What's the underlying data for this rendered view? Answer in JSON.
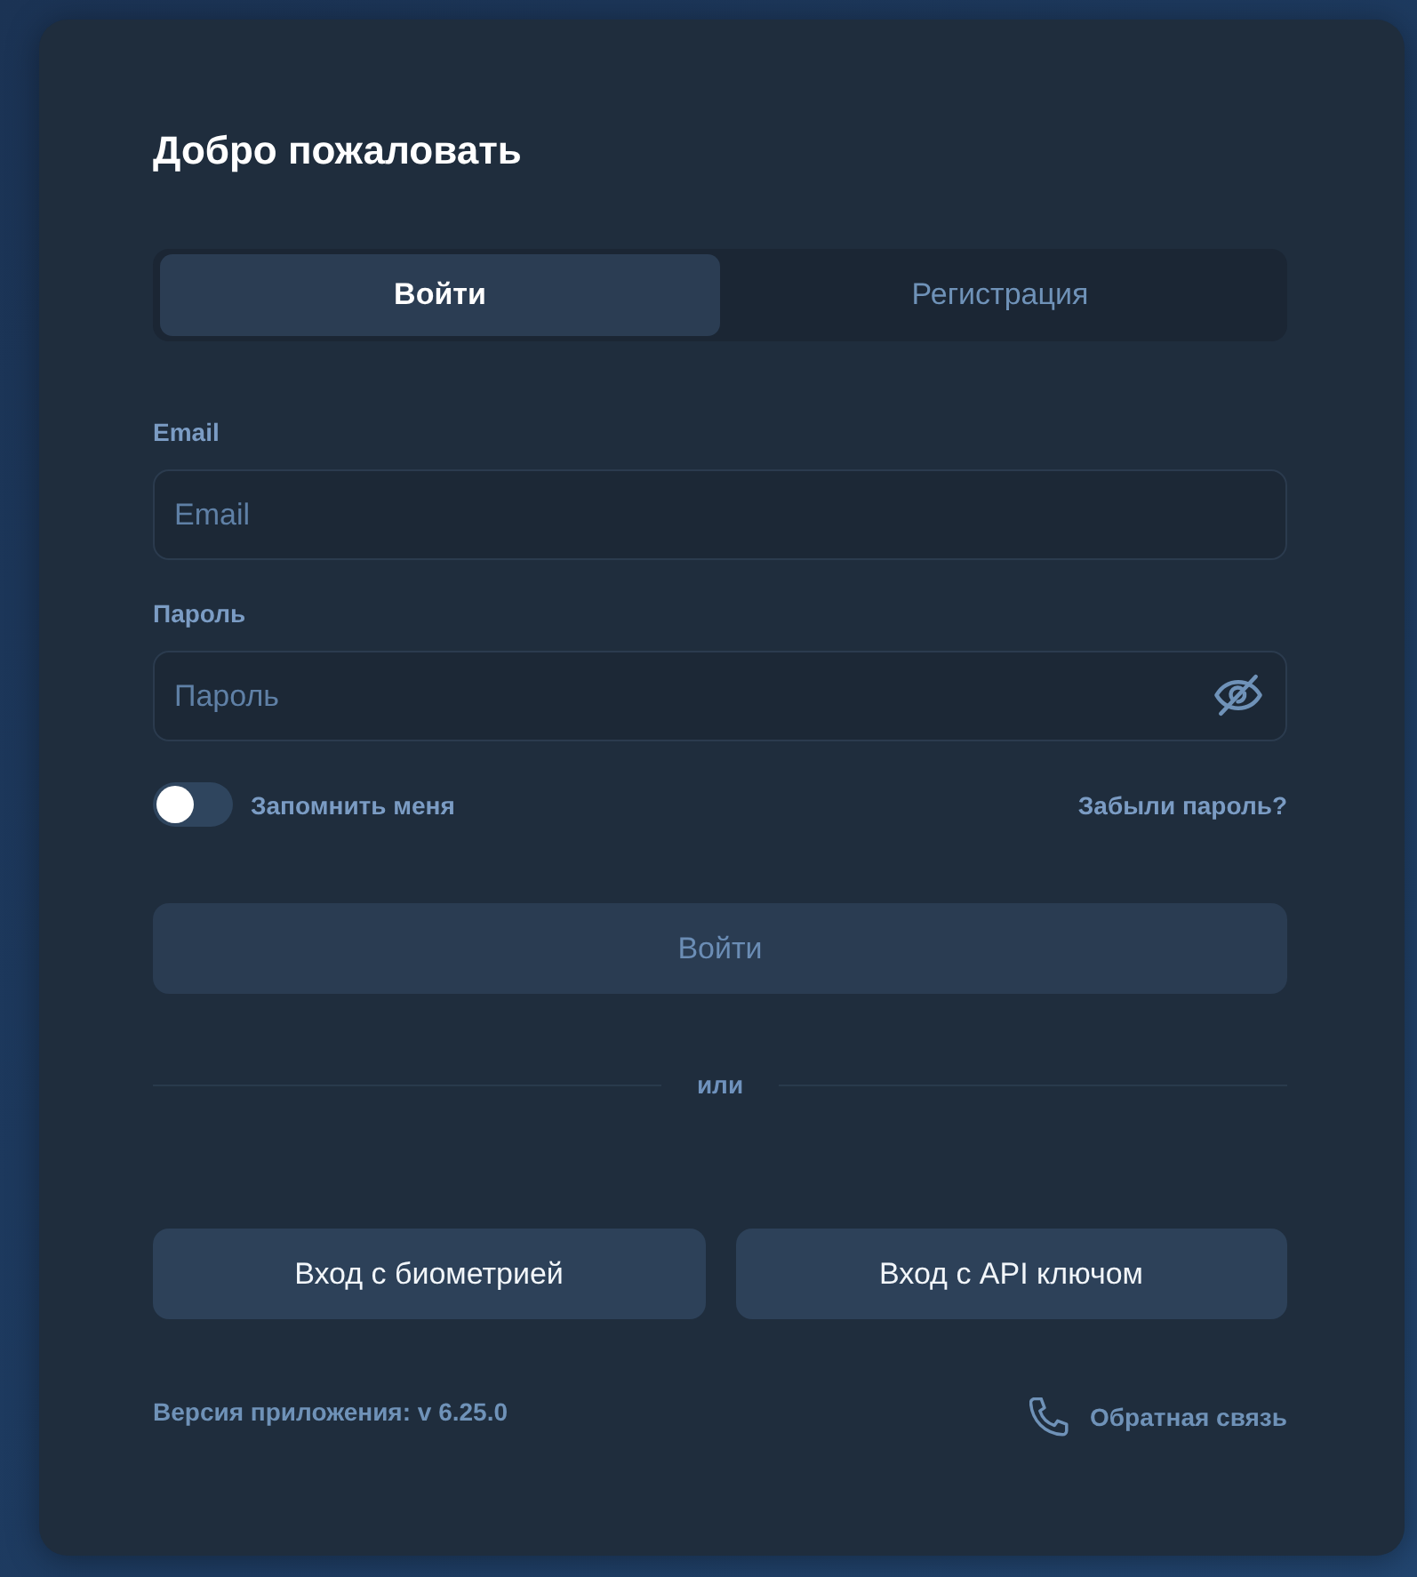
{
  "title": "Добро пожаловать",
  "tabs": [
    {
      "label": "Войти",
      "selected": true
    },
    {
      "label": "Регистрация",
      "selected": false
    }
  ],
  "fields": [
    {
      "kind": "text",
      "label": "Email",
      "placeholder": "Email"
    },
    {
      "kind": "password",
      "label": "Пароль",
      "placeholder": "Пароль"
    }
  ],
  "remember": {
    "label": "Запомнить меня",
    "on": false
  },
  "forgot_link": "Забыли пароль?",
  "submit": {
    "label": "Войти",
    "disabled": true
  },
  "divider": "или",
  "alt_buttons": [
    "Вход с биометрией",
    "Вход с API ключом"
  ],
  "footer": {
    "version": "Версия приложения: v 6.25.0",
    "feedback": "Обратная связь"
  }
}
